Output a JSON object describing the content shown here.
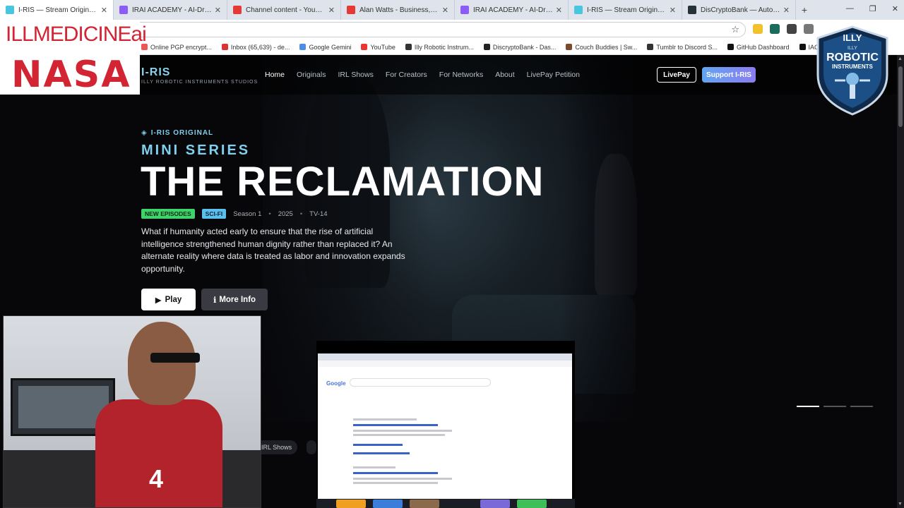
{
  "browser": {
    "tabs": [
      {
        "title": "I-RIS — Stream Original Series",
        "color": "#48c6e0",
        "active": true
      },
      {
        "title": "IRAI ACADEMY - AI-Driven Dev",
        "color": "#8b5cf6"
      },
      {
        "title": "Channel content - YouTube Stu",
        "color": "#e53935"
      },
      {
        "title": "Alan Watts - Business, Propaga",
        "color": "#e53935"
      },
      {
        "title": "IRAI ACADEMY - AI-Driven Dev",
        "color": "#8b5cf6"
      },
      {
        "title": "I-RIS — Stream Original Series",
        "color": "#48c6e0"
      },
      {
        "title": "DisCryptoBank — Autonomous",
        "color": "#263238"
      }
    ],
    "bookmarks": [
      {
        "label": "Online PGP encrypt...",
        "color": "#e55"
      },
      {
        "label": "Inbox (65,639) - de...",
        "color": "#d33"
      },
      {
        "label": "Google Gemini",
        "color": "#4a8fe6"
      },
      {
        "label": "YouTube",
        "color": "#e33"
      },
      {
        "label": "Illy Robotic Instrum...",
        "color": "#333"
      },
      {
        "label": "DiscryptoBank - Das...",
        "color": "#222"
      },
      {
        "label": "Couch Buddies | Sw...",
        "color": "#7a4a2a"
      },
      {
        "label": "Tumblr to Discord S...",
        "color": "#333"
      },
      {
        "label": "GitHub Dashboard",
        "color": "#111"
      },
      {
        "label": "IACOB",
        "color": "#111"
      }
    ]
  },
  "overlay": {
    "channel_text": "ILLMEDICINEai",
    "nasa_text": "NASA",
    "logo_top": "ILLY",
    "logo_mid1": "ROBOTIC",
    "logo_mid2": "INSTRUMENTS",
    "logo_small": "ILLY"
  },
  "site": {
    "brand": "I-RIS",
    "brand_sub": "ILLY ROBOTIC INSTRUMENTS STUDIOS",
    "nav": [
      "Home",
      "Originals",
      "IRL Shows",
      "For Creators",
      "For Networks",
      "About",
      "LivePay Petition"
    ],
    "btn_livepay": "LivePay",
    "btn_support": "Support I-RIS"
  },
  "hero": {
    "eyebrow": "I-RIS ORIGINAL",
    "series": "MINI SERIES",
    "title": "THE RECLAMATION",
    "badge_new": "NEW EPISODES",
    "badge_genre": "SCI-FI",
    "season": "Season 1",
    "year": "2025",
    "rating": "TV-14",
    "description": "What if humanity acted early to ensure that the rise of artificial intelligence strengthened human dignity rather than replaced it? An alternate reality where data is treated as labor and innovation expands opportunity.",
    "play_label": "Play",
    "info_label": "More Info",
    "chip_label": "IRL Shows"
  },
  "webcam": {
    "shirt_number": "4"
  }
}
